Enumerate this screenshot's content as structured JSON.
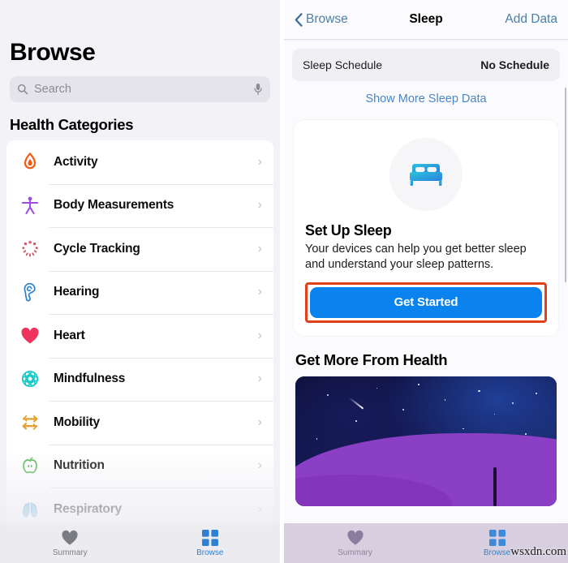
{
  "left_screen": {
    "title": "Browse",
    "search": {
      "placeholder": "Search",
      "value": "",
      "search_icon": "search-icon",
      "mic_icon": "microphone-icon"
    },
    "section_header": "Health Categories",
    "categories": [
      {
        "label": "Activity",
        "icon": "flame-icon",
        "color": "#f05a14"
      },
      {
        "label": "Body Measurements",
        "icon": "person-icon",
        "color": "#9a4fe0"
      },
      {
        "label": "Cycle Tracking",
        "icon": "cycle-icon",
        "color": "#d1596a"
      },
      {
        "label": "Hearing",
        "icon": "ear-icon",
        "color": "#2b7fc4"
      },
      {
        "label": "Heart",
        "icon": "heart-icon",
        "color": "#f0335e"
      },
      {
        "label": "Mindfulness",
        "icon": "brain-icon",
        "color": "#12c9c4"
      },
      {
        "label": "Mobility",
        "icon": "arrows-icon",
        "color": "#e3a235"
      },
      {
        "label": "Nutrition",
        "icon": "apple-icon",
        "color": "#4fb84f"
      },
      {
        "label": "Respiratory",
        "icon": "lungs-icon",
        "color": "#54a8dd"
      }
    ],
    "chevron": "›",
    "tabbar": {
      "tabs": [
        {
          "label": "Summary",
          "icon": "heart-icon",
          "active": false
        },
        {
          "label": "Browse",
          "icon": "grid-icon",
          "active": true
        }
      ]
    }
  },
  "right_screen": {
    "navbar": {
      "back_label": "Browse",
      "back_icon": "chevron-left-icon",
      "title": "Sleep",
      "action_label": "Add Data"
    },
    "schedule": {
      "label": "Sleep Schedule",
      "value": "No Schedule"
    },
    "show_more_link": "Show More Sleep Data",
    "setup_card": {
      "icon": "bed-icon",
      "title": "Set Up Sleep",
      "description": "Your devices can help you get better sleep and understand your sleep patterns.",
      "button_label": "Get Started",
      "button_color": "#0b83ef",
      "highlight_color": "#e2401c"
    },
    "more_section": {
      "header": "Get More From Health",
      "promo_image": "night-sky-hill-illustration"
    },
    "tabbar": {
      "tabs": [
        {
          "label": "Summary",
          "icon": "heart-icon",
          "active": false
        },
        {
          "label": "Browse",
          "icon": "grid-icon",
          "active": true
        }
      ]
    }
  },
  "watermark": "wsxdn.com"
}
